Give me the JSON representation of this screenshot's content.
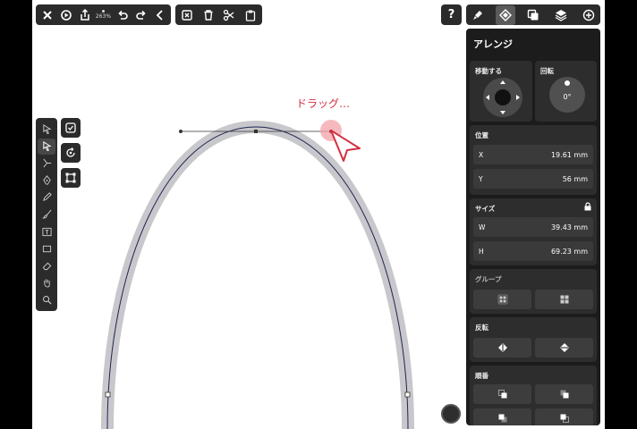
{
  "toolbar": {
    "zoom_label": "263%"
  },
  "help": {
    "label": "?"
  },
  "canvas": {
    "drag_hint": "ドラッグ…"
  },
  "panel": {
    "title": "アレンジ",
    "move": {
      "label": "移動する"
    },
    "rotation": {
      "label": "回転",
      "value": "0°"
    },
    "position": {
      "label": "位置",
      "x_label": "X",
      "x_value": "19.61 mm",
      "y_label": "Y",
      "y_value": "56 mm"
    },
    "size": {
      "label": "サイズ",
      "w_label": "W",
      "w_value": "39.43 mm",
      "h_label": "H",
      "h_value": "69.23 mm"
    },
    "group": {
      "label": "グループ"
    },
    "flip": {
      "label": "反転"
    },
    "order": {
      "label": "順番"
    }
  },
  "colors": {
    "accent_red": "#d23040",
    "panel_bg": "#1c1c1c",
    "toolbar_bg": "#2b2b2b"
  }
}
